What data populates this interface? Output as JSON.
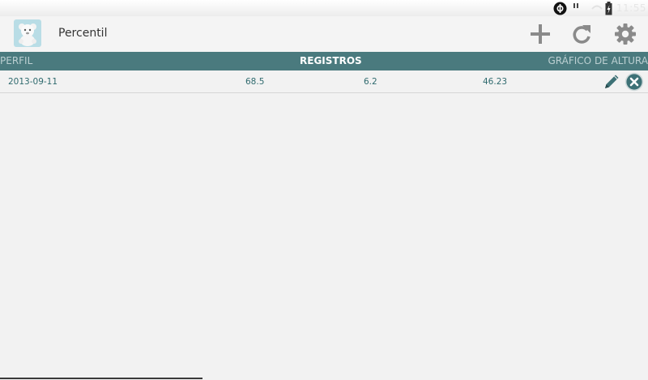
{
  "status_bar": {
    "clock": "11:55"
  },
  "app": {
    "title": "Percentil",
    "icon": "teddy-bear-icon"
  },
  "actions": [
    {
      "name": "add",
      "icon": "plus-icon"
    },
    {
      "name": "refresh",
      "icon": "refresh-icon"
    },
    {
      "name": "settings",
      "icon": "gear-icon"
    }
  ],
  "tabs": {
    "left": "PERFIL",
    "center": "REGISTROS",
    "right": "GRÁFICO DE ALTURA"
  },
  "records": [
    {
      "date": "2013-09-11",
      "v1": "68.5",
      "v2": "6.2",
      "v3": "46.23"
    }
  ],
  "colors": {
    "tab_bar": "#4a7a7e",
    "row_text": "#2f6a6e",
    "icon_gray": "#8a8a8a"
  }
}
